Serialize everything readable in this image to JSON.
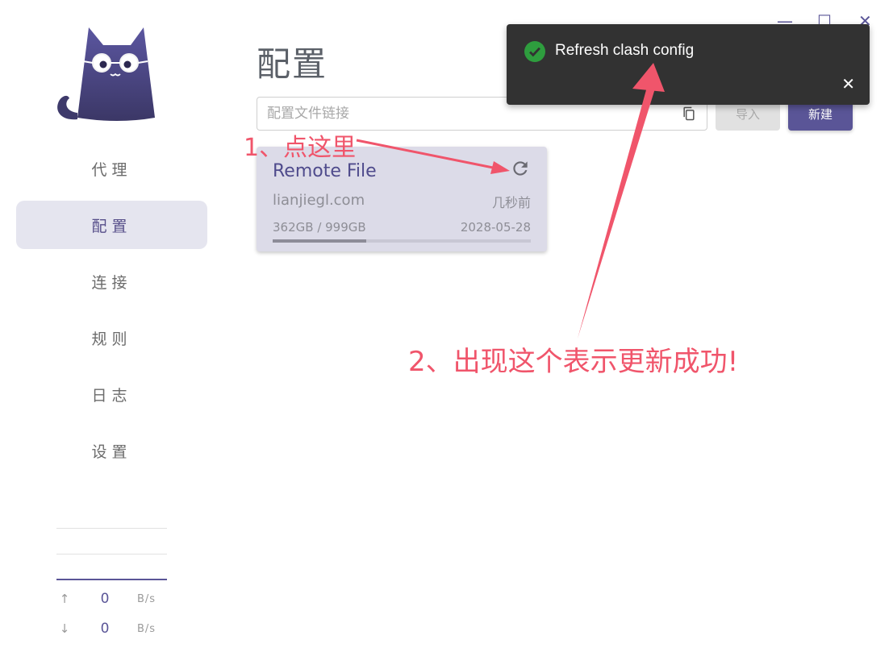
{
  "window": {
    "minimize_glyph": "—",
    "maximize_glyph": "☐",
    "close_glyph": "✕"
  },
  "sidebar": {
    "logo": "cat-logo-icon",
    "items": [
      {
        "label": "代理",
        "active": false
      },
      {
        "label": "配置",
        "active": true
      },
      {
        "label": "连接",
        "active": false
      },
      {
        "label": "规则",
        "active": false
      },
      {
        "label": "日志",
        "active": false
      },
      {
        "label": "设置",
        "active": false
      }
    ],
    "traffic": {
      "up_value": "0",
      "up_unit": "B/s",
      "down_value": "0",
      "down_unit": "B/s"
    }
  },
  "main": {
    "title": "配置",
    "url_input": {
      "placeholder": "配置文件链接",
      "value": ""
    },
    "import_label": "导入",
    "new_label": "新建"
  },
  "profile_card": {
    "title": "Remote File",
    "url": "lianjiegl.com",
    "updated": "几秒前",
    "usage": "362GB / 999GB",
    "expire": "2028-05-28",
    "usage_ratio": 0.362
  },
  "toast": {
    "message": "Refresh clash config",
    "status": "success"
  },
  "annotations": {
    "step1": "1、点这里",
    "step2": "2、出现这个表示更新成功!"
  },
  "colors": {
    "accent": "#5a5597",
    "annotation": "#f0556b",
    "toast_bg": "#323232",
    "success": "#2e9d3e"
  }
}
